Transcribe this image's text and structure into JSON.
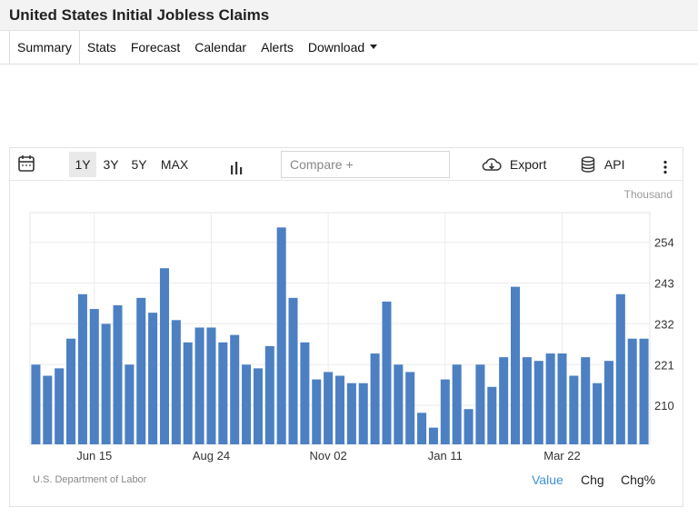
{
  "page": {
    "title": "United States Initial Jobless Claims"
  },
  "tabs": [
    {
      "label": "Summary",
      "active": true
    },
    {
      "label": "Stats"
    },
    {
      "label": "Forecast"
    },
    {
      "label": "Calendar"
    },
    {
      "label": "Alerts"
    },
    {
      "label": "Download",
      "dropdown": true
    }
  ],
  "toolbar": {
    "ranges": [
      "1Y",
      "3Y",
      "5Y",
      "MAX"
    ],
    "active_range": "1Y",
    "compare_placeholder": "Compare +",
    "export_label": "Export",
    "api_label": "API",
    "icons": [
      "calendar-icon",
      "bar-chart-icon",
      "cloud-download-icon",
      "database-icon",
      "more-vertical-icon"
    ]
  },
  "chart_data": {
    "type": "bar",
    "unit_label": "Thousand",
    "source": "U.S. Department of Labor",
    "color": "#4c80c2",
    "x_ticks": [
      "Jun 15",
      "Aug 24",
      "Nov 02",
      "Jan 11",
      "Mar 22"
    ],
    "y_ticks": [
      "254",
      "243",
      "232",
      "221",
      "210"
    ],
    "ylim": [
      199.5,
      262
    ],
    "grid": true,
    "values": [
      221,
      218,
      220,
      228,
      240,
      236,
      232,
      237,
      221,
      239,
      235,
      247,
      233,
      227,
      231,
      231,
      227,
      229,
      221,
      220,
      226,
      258,
      239,
      227,
      217,
      219,
      218,
      216,
      216,
      224,
      238,
      221,
      219,
      208,
      204,
      217,
      221,
      209,
      221,
      215,
      223,
      242,
      223,
      222,
      224,
      224,
      218,
      223,
      216,
      222,
      240,
      228,
      228
    ]
  },
  "value_toggles": [
    {
      "label": "Value",
      "selected": true
    },
    {
      "label": "Chg"
    },
    {
      "label": "Chg%"
    }
  ]
}
